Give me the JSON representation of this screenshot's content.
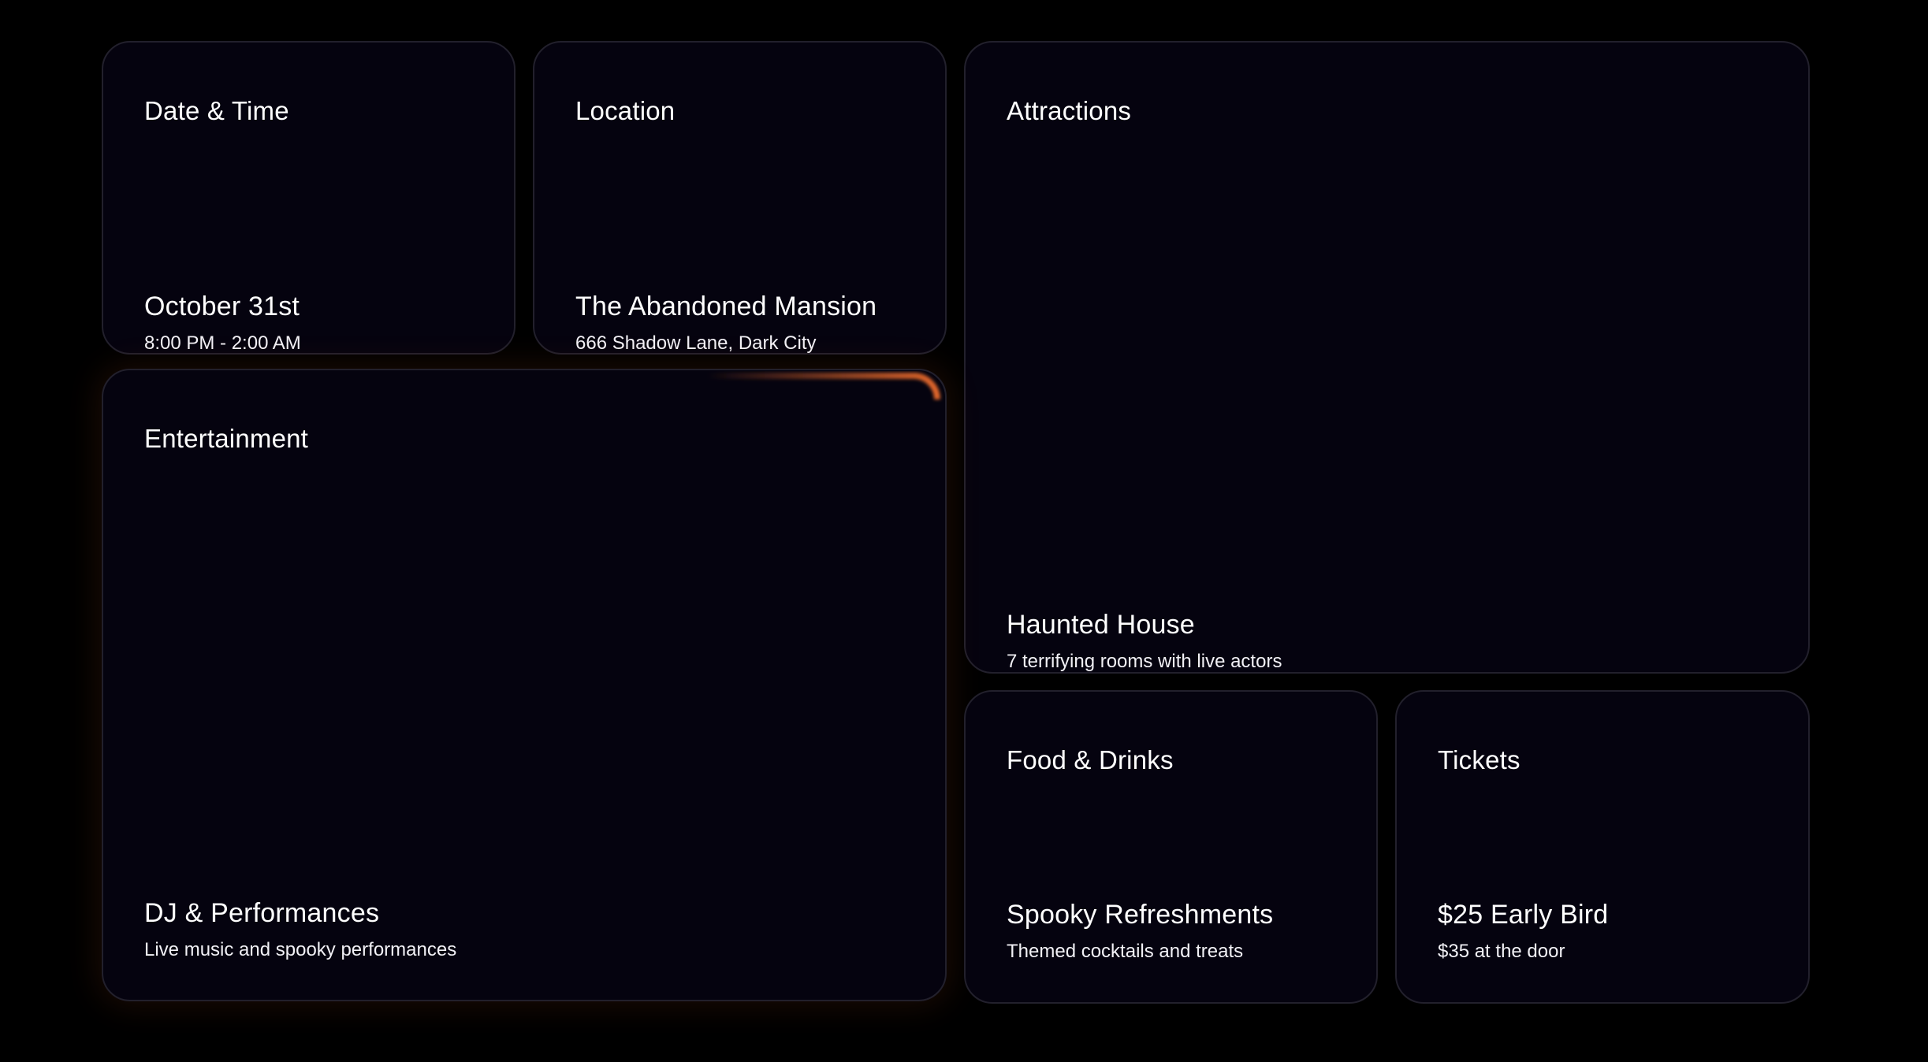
{
  "cards": {
    "datetime": {
      "title": "Date & Time",
      "primary": "October 31st",
      "secondary": "8:00 PM - 2:00 AM"
    },
    "location": {
      "title": "Location",
      "primary": "The Abandoned Mansion",
      "secondary": "666 Shadow Lane, Dark City"
    },
    "attractions": {
      "title": "Attractions",
      "primary": "Haunted House",
      "secondary": "7 terrifying rooms with live actors"
    },
    "entertainment": {
      "title": "Entertainment",
      "primary": "DJ & Performances",
      "secondary": "Live music and spooky performances"
    },
    "food": {
      "title": "Food & Drinks",
      "primary": "Spooky Refreshments",
      "secondary": "Themed cocktails and treats"
    },
    "tickets": {
      "title": "Tickets",
      "primary": "$25 Early Bird",
      "secondary": "$35 at the door"
    }
  },
  "colors": {
    "background": "#000000",
    "card": "#05030f",
    "border": "#22202c",
    "accent_glow": "#e0662a"
  }
}
